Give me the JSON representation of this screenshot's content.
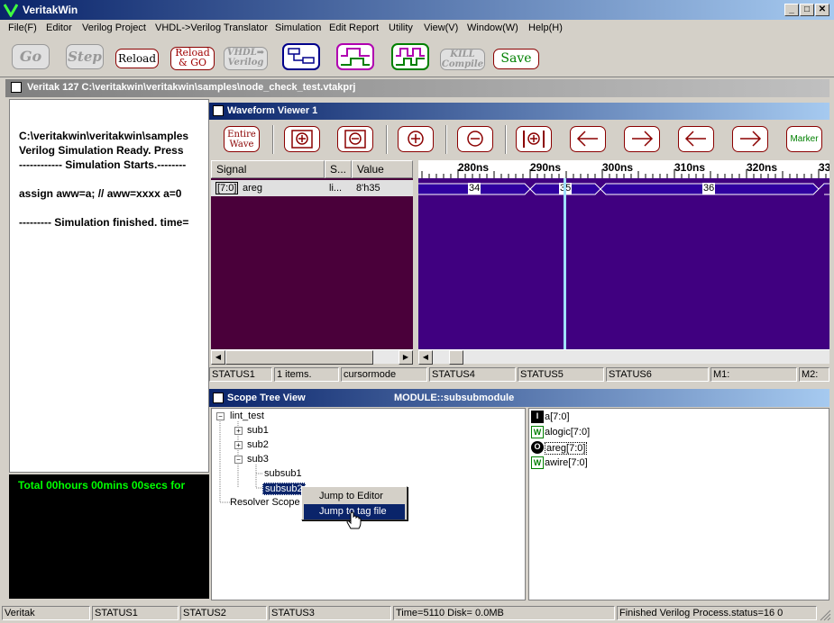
{
  "app": {
    "title": "VeritakWin"
  },
  "window_controls": {
    "minimize": "_",
    "maximize": "□",
    "close": "✕"
  },
  "menu": [
    "File(F)",
    "Editor",
    "Verilog Project",
    "VHDL->Verilog Translator",
    "Simulation",
    "Edit Report",
    "Utility",
    "View(V)",
    "Window(W)",
    "Help(H)"
  ],
  "toolbar": {
    "go": "Go",
    "step": "Step",
    "reload": "Reload",
    "reload_go_1": "Reload",
    "reload_go_2": "& GO",
    "vhdl_1": "VHDL➡",
    "vhdl_2": "Verilog",
    "kill_1": "KILL",
    "kill_2": "Compile",
    "save": "Save"
  },
  "project": {
    "title": "Veritak 127 C:\\veritakwin\\veritakwin\\samples\\node_check_test.vtakprj"
  },
  "log": {
    "lines": [
      "C:\\veritakwin\\veritakwin\\samples",
      "Verilog Simulation Ready. Press",
      "------------ Simulation Starts.--------",
      "assign aww=a; // aww=xxxx a=0",
      "--------- Simulation finished. time="
    ],
    "console": "Total  00hours 00mins 00secs for"
  },
  "waveform": {
    "title": "Waveform Viewer 1",
    "btn_entire_1": "Entire",
    "btn_entire_2": "Wave",
    "btn_marker": "Marker",
    "headers": {
      "signal": "Signal",
      "s": "S...",
      "value": "Value"
    },
    "row": {
      "bits": "[7:0]",
      "name": "areg",
      "s": "li...",
      "value": "8'h35"
    },
    "ticks": [
      "280ns",
      "290ns",
      "300ns",
      "310ns",
      "320ns",
      "33"
    ],
    "values": [
      "34",
      "35",
      "36"
    ],
    "status": [
      "STATUS1",
      "1 items.",
      "cursormode",
      "STATUS4",
      "STATUS5",
      "STATUS6",
      "M1:",
      "M2:"
    ]
  },
  "scope": {
    "title": "Scope Tree View",
    "module": "MODULE::subsubmodule",
    "tree": {
      "root": "lint_test",
      "sub1": "sub1",
      "sub2": "sub2",
      "sub3": "sub3",
      "subsub1": "subsub1",
      "subsub2": "subsub2",
      "resolver": "Resolver Scope"
    },
    "signals": [
      {
        "icon": "I",
        "name": "a[7:0]"
      },
      {
        "icon": "W",
        "name": "alogic[7:0]"
      },
      {
        "icon": "O",
        "name": "areg[7:0]"
      },
      {
        "icon": "W",
        "name": "awire[7:0]"
      }
    ]
  },
  "context_menu": {
    "jump_editor": "Jump to Editor",
    "jump_tag": "Jump to tag file"
  },
  "statusbar": [
    "Veritak",
    "STATUS1",
    "STATUS2",
    "STATUS3",
    "Time=5110 Disk=  0.0MB",
    "Finished Verilog Process.status=16 0"
  ],
  "colors": {
    "signal_bg": "#4a003a",
    "wave_bg": "#400080",
    "cursor": "#a0e0ff",
    "active_title": "#0a246a"
  }
}
